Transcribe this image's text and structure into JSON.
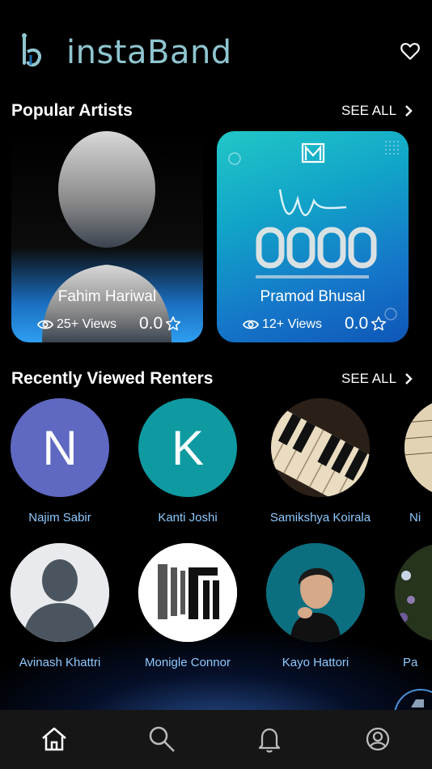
{
  "app": {
    "title": "instaBand"
  },
  "popular": {
    "title": "Popular Artists",
    "see_all": "SEE ALL",
    "artists": [
      {
        "name": "Fahim Hariwal",
        "views": "25+ Views",
        "rating": "0.0"
      },
      {
        "name": "Pramod Bhusal",
        "views": "12+ Views",
        "rating": "0.0"
      }
    ]
  },
  "recent": {
    "title": "Recently Viewed Renters",
    "see_all": "SEE ALL",
    "row1": [
      {
        "name": "Najim Sabir",
        "initial": "N",
        "color": "#5f69c2"
      },
      {
        "name": "Kanti Joshi",
        "initial": "K",
        "color": "#0e9aa0"
      },
      {
        "name": "Samikshya Koirala"
      },
      {
        "name": "Ni"
      }
    ],
    "row2": [
      {
        "name": "Avinash Khattri"
      },
      {
        "name": "Monigle Connor"
      },
      {
        "name": "Kayo Hattori"
      },
      {
        "name": "Pa"
      }
    ]
  },
  "colors": {
    "accent": "#8fc5cf",
    "link": "#8ec9ff",
    "card_blue": "#2e9ff0"
  },
  "nav": {
    "items": [
      "home-icon",
      "search-icon",
      "bell-icon",
      "profile-icon"
    ]
  }
}
